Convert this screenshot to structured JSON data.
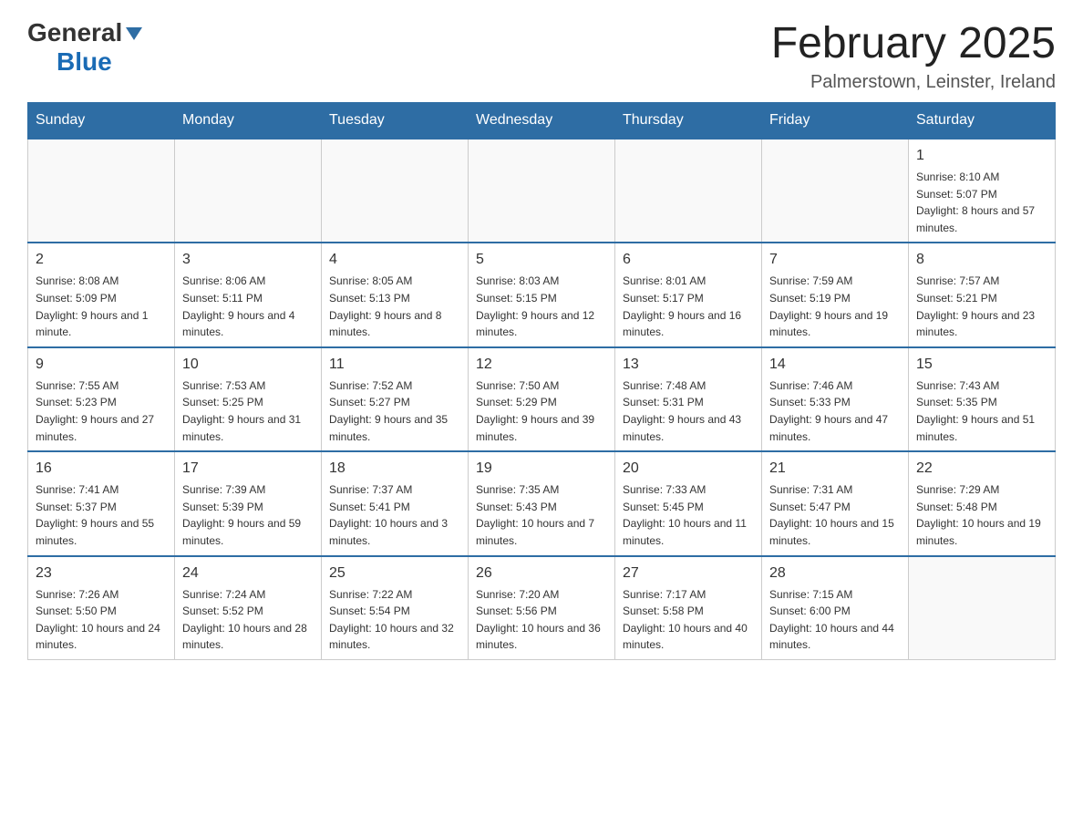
{
  "header": {
    "logo_general": "General",
    "logo_blue": "Blue",
    "month_title": "February 2025",
    "location": "Palmerstown, Leinster, Ireland"
  },
  "weekdays": [
    "Sunday",
    "Monday",
    "Tuesday",
    "Wednesday",
    "Thursday",
    "Friday",
    "Saturday"
  ],
  "weeks": [
    [
      {
        "day": "",
        "info": ""
      },
      {
        "day": "",
        "info": ""
      },
      {
        "day": "",
        "info": ""
      },
      {
        "day": "",
        "info": ""
      },
      {
        "day": "",
        "info": ""
      },
      {
        "day": "",
        "info": ""
      },
      {
        "day": "1",
        "info": "Sunrise: 8:10 AM\nSunset: 5:07 PM\nDaylight: 8 hours and 57 minutes."
      }
    ],
    [
      {
        "day": "2",
        "info": "Sunrise: 8:08 AM\nSunset: 5:09 PM\nDaylight: 9 hours and 1 minute."
      },
      {
        "day": "3",
        "info": "Sunrise: 8:06 AM\nSunset: 5:11 PM\nDaylight: 9 hours and 4 minutes."
      },
      {
        "day": "4",
        "info": "Sunrise: 8:05 AM\nSunset: 5:13 PM\nDaylight: 9 hours and 8 minutes."
      },
      {
        "day": "5",
        "info": "Sunrise: 8:03 AM\nSunset: 5:15 PM\nDaylight: 9 hours and 12 minutes."
      },
      {
        "day": "6",
        "info": "Sunrise: 8:01 AM\nSunset: 5:17 PM\nDaylight: 9 hours and 16 minutes."
      },
      {
        "day": "7",
        "info": "Sunrise: 7:59 AM\nSunset: 5:19 PM\nDaylight: 9 hours and 19 minutes."
      },
      {
        "day": "8",
        "info": "Sunrise: 7:57 AM\nSunset: 5:21 PM\nDaylight: 9 hours and 23 minutes."
      }
    ],
    [
      {
        "day": "9",
        "info": "Sunrise: 7:55 AM\nSunset: 5:23 PM\nDaylight: 9 hours and 27 minutes."
      },
      {
        "day": "10",
        "info": "Sunrise: 7:53 AM\nSunset: 5:25 PM\nDaylight: 9 hours and 31 minutes."
      },
      {
        "day": "11",
        "info": "Sunrise: 7:52 AM\nSunset: 5:27 PM\nDaylight: 9 hours and 35 minutes."
      },
      {
        "day": "12",
        "info": "Sunrise: 7:50 AM\nSunset: 5:29 PM\nDaylight: 9 hours and 39 minutes."
      },
      {
        "day": "13",
        "info": "Sunrise: 7:48 AM\nSunset: 5:31 PM\nDaylight: 9 hours and 43 minutes."
      },
      {
        "day": "14",
        "info": "Sunrise: 7:46 AM\nSunset: 5:33 PM\nDaylight: 9 hours and 47 minutes."
      },
      {
        "day": "15",
        "info": "Sunrise: 7:43 AM\nSunset: 5:35 PM\nDaylight: 9 hours and 51 minutes."
      }
    ],
    [
      {
        "day": "16",
        "info": "Sunrise: 7:41 AM\nSunset: 5:37 PM\nDaylight: 9 hours and 55 minutes."
      },
      {
        "day": "17",
        "info": "Sunrise: 7:39 AM\nSunset: 5:39 PM\nDaylight: 9 hours and 59 minutes."
      },
      {
        "day": "18",
        "info": "Sunrise: 7:37 AM\nSunset: 5:41 PM\nDaylight: 10 hours and 3 minutes."
      },
      {
        "day": "19",
        "info": "Sunrise: 7:35 AM\nSunset: 5:43 PM\nDaylight: 10 hours and 7 minutes."
      },
      {
        "day": "20",
        "info": "Sunrise: 7:33 AM\nSunset: 5:45 PM\nDaylight: 10 hours and 11 minutes."
      },
      {
        "day": "21",
        "info": "Sunrise: 7:31 AM\nSunset: 5:47 PM\nDaylight: 10 hours and 15 minutes."
      },
      {
        "day": "22",
        "info": "Sunrise: 7:29 AM\nSunset: 5:48 PM\nDaylight: 10 hours and 19 minutes."
      }
    ],
    [
      {
        "day": "23",
        "info": "Sunrise: 7:26 AM\nSunset: 5:50 PM\nDaylight: 10 hours and 24 minutes."
      },
      {
        "day": "24",
        "info": "Sunrise: 7:24 AM\nSunset: 5:52 PM\nDaylight: 10 hours and 28 minutes."
      },
      {
        "day": "25",
        "info": "Sunrise: 7:22 AM\nSunset: 5:54 PM\nDaylight: 10 hours and 32 minutes."
      },
      {
        "day": "26",
        "info": "Sunrise: 7:20 AM\nSunset: 5:56 PM\nDaylight: 10 hours and 36 minutes."
      },
      {
        "day": "27",
        "info": "Sunrise: 7:17 AM\nSunset: 5:58 PM\nDaylight: 10 hours and 40 minutes."
      },
      {
        "day": "28",
        "info": "Sunrise: 7:15 AM\nSunset: 6:00 PM\nDaylight: 10 hours and 44 minutes."
      },
      {
        "day": "",
        "info": ""
      }
    ]
  ]
}
